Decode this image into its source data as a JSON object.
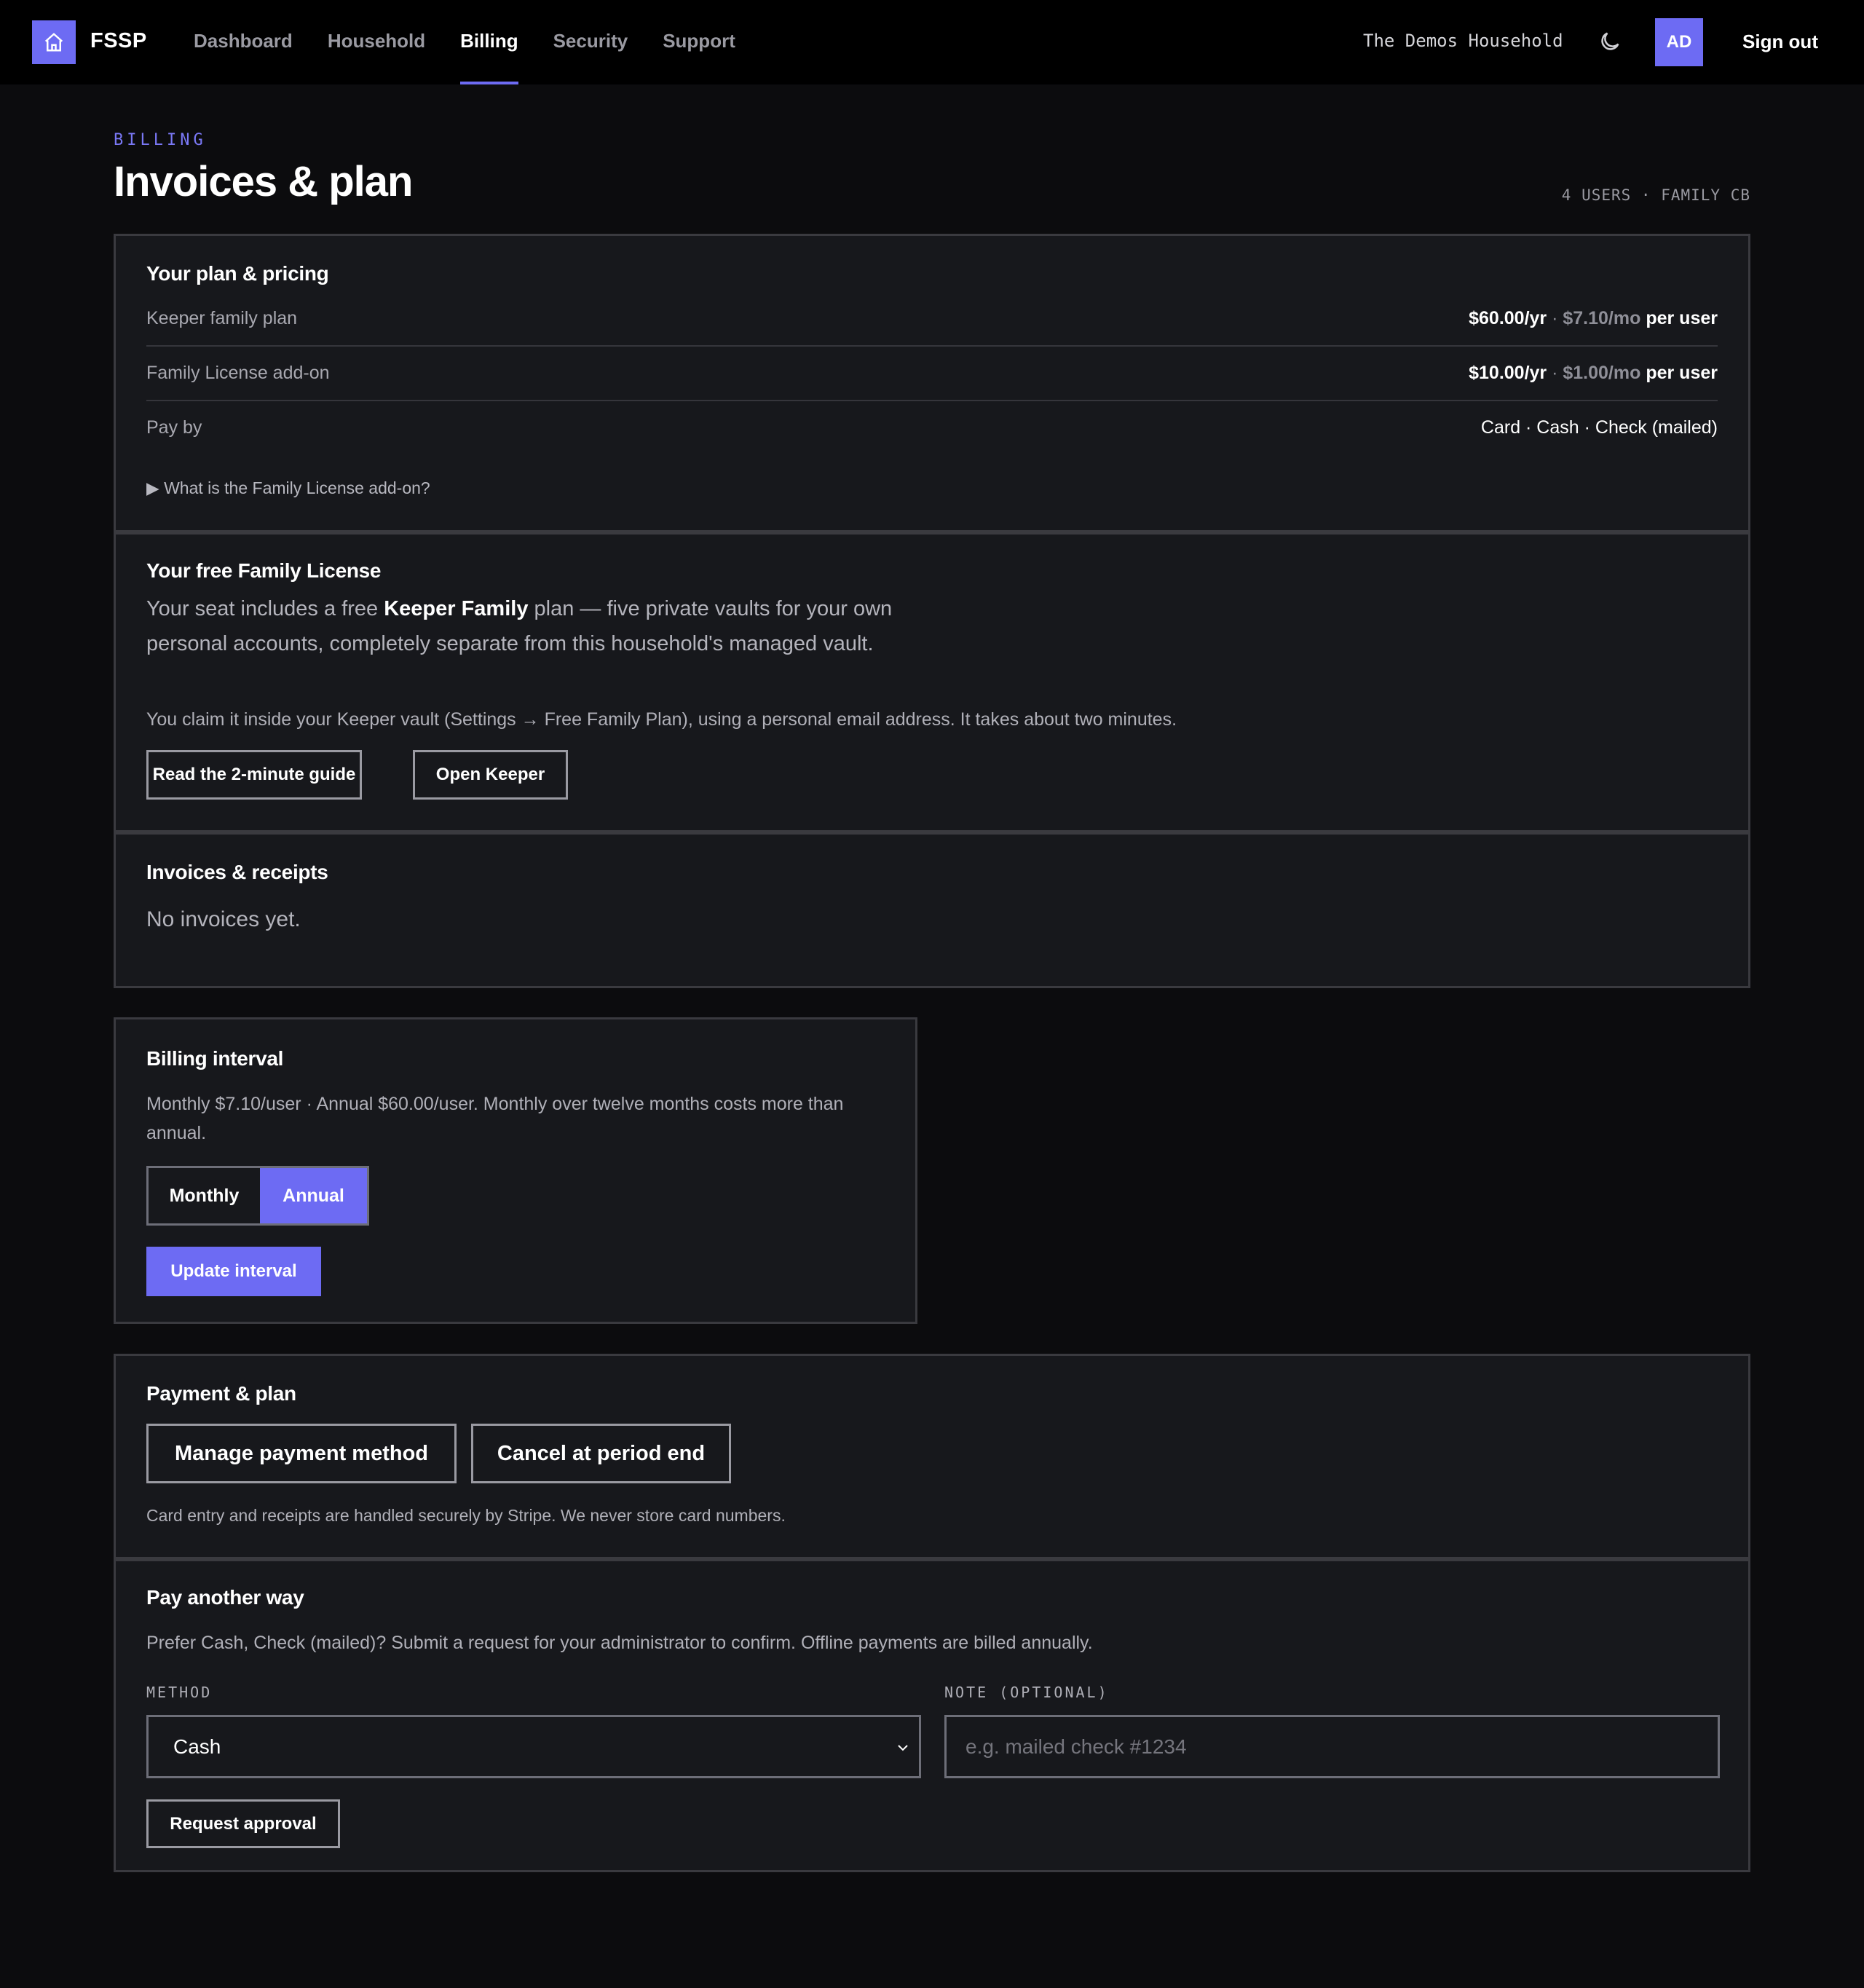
{
  "nav": {
    "brand": "FSSP",
    "links": [
      "Dashboard",
      "Household",
      "Billing",
      "Security",
      "Support"
    ],
    "active": "Billing",
    "household_name": "The Demos Household",
    "avatar_initials": "AD",
    "sign_out": "Sign out",
    "accent_color": "#6d6bf3"
  },
  "header": {
    "eyebrow": "BILLING",
    "title": "Invoices & plan",
    "meta": "4 USERS · FAMILY CB"
  },
  "plan_pricing": {
    "title": "Your plan & pricing",
    "rows": [
      {
        "label": "Keeper family plan",
        "annual": "$60.00/yr",
        "separator": " · ",
        "monthly": "$7.10/mo",
        "suffix": " per user"
      },
      {
        "label": "Family License add-on",
        "annual": "$10.00/yr",
        "separator": " · ",
        "monthly": "$1.00/mo",
        "suffix": " per user"
      }
    ],
    "pay_by_label": "Pay by",
    "pay_by_value": "Card · Cash · Check (mailed)",
    "details_summary": "▶ What is the Family License add-on?"
  },
  "free_license": {
    "title": "Your free Family License",
    "lead_before": "Your seat includes a free ",
    "lead_bold": "Keeper Family",
    "lead_after": " plan — five private vaults for your own personal accounts, completely separate from this household's managed vault.",
    "body": "You claim it inside your Keeper vault (Settings → Free Family Plan), using a personal email address. It takes about two minutes.",
    "guide_button": "Read the 2-minute guide",
    "open_button": "Open Keeper"
  },
  "invoices": {
    "title": "Invoices & receipts",
    "empty": "No invoices yet."
  },
  "billing_interval": {
    "title": "Billing interval",
    "description": "Monthly $7.10/user · Annual $60.00/user. Monthly over twelve months costs more than annual.",
    "options": [
      "Monthly",
      "Annual"
    ],
    "selected": "Annual",
    "update_button": "Update interval"
  },
  "payment_plan": {
    "title": "Payment & plan",
    "manage_button": "Manage payment method",
    "cancel_button": "Cancel at period end",
    "note": "Card entry and receipts are handled securely by Stripe. We never store card numbers."
  },
  "pay_another": {
    "title": "Pay another way",
    "description": "Prefer Cash, Check (mailed)? Submit a request for your administrator to confirm. Offline payments are billed annually.",
    "method_label": "METHOD",
    "method_value": "Cash",
    "note_label": "NOTE (OPTIONAL)",
    "note_placeholder": "e.g. mailed check #1234",
    "request_button": "Request approval"
  }
}
